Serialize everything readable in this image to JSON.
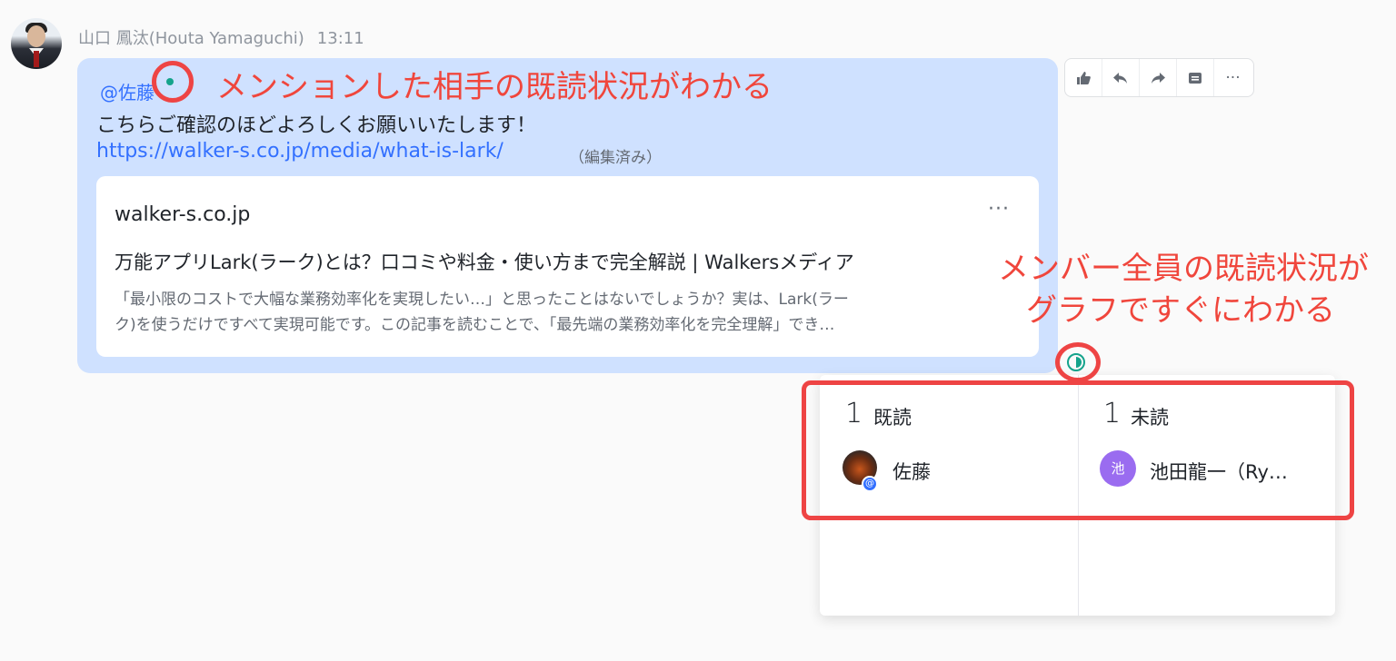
{
  "sender": {
    "name": "山口 鳳汰(Houta Yamaguchi)",
    "time": "13:11"
  },
  "message": {
    "mention": "@佐藤",
    "text": "こちらご確認のほどよろしくお願いいたします！",
    "link": "https://walker-s.co.jp/media/what-is-lark/",
    "edited": "（編集済み）"
  },
  "card": {
    "domain": "walker-s.co.jp",
    "more": "···",
    "title": "万能アプリLark(ラーク)とは？口コミや料金・使い方まで完全解説 | Walkersメディア",
    "desc_line1": "「最小限のコストで大幅な業務効率化を実現したい…」と思ったことはないでしょうか？実は、Lark(ラー",
    "desc_line2": "ク)を使うだけですべて実現可能です。この記事を読むことで、「最先端の業務効率化を完全理解」でき…"
  },
  "toolbar": {
    "items": [
      "thumbs-up-icon",
      "reply-icon",
      "forward-icon",
      "pin-icon",
      "more-icon"
    ],
    "more_label": "···"
  },
  "annotations": {
    "mention_status": "メンションした相手の既読状況がわかる",
    "graph_line1": "メンバー全員の既読状況が",
    "graph_line2": "グラフですぐにわかる",
    "color": "#f0463c"
  },
  "read_status": {
    "read": {
      "count": "1",
      "label": "既読",
      "users": [
        {
          "name": "佐藤",
          "badge": "@"
        }
      ]
    },
    "unread": {
      "count": "1",
      "label": "未読",
      "users": [
        {
          "name": "池田龍一（Ry…",
          "initial": "池"
        }
      ]
    }
  },
  "colors": {
    "bubble": "#cfe1ff",
    "link": "#3370ff",
    "read_icon": "#14a38b"
  }
}
